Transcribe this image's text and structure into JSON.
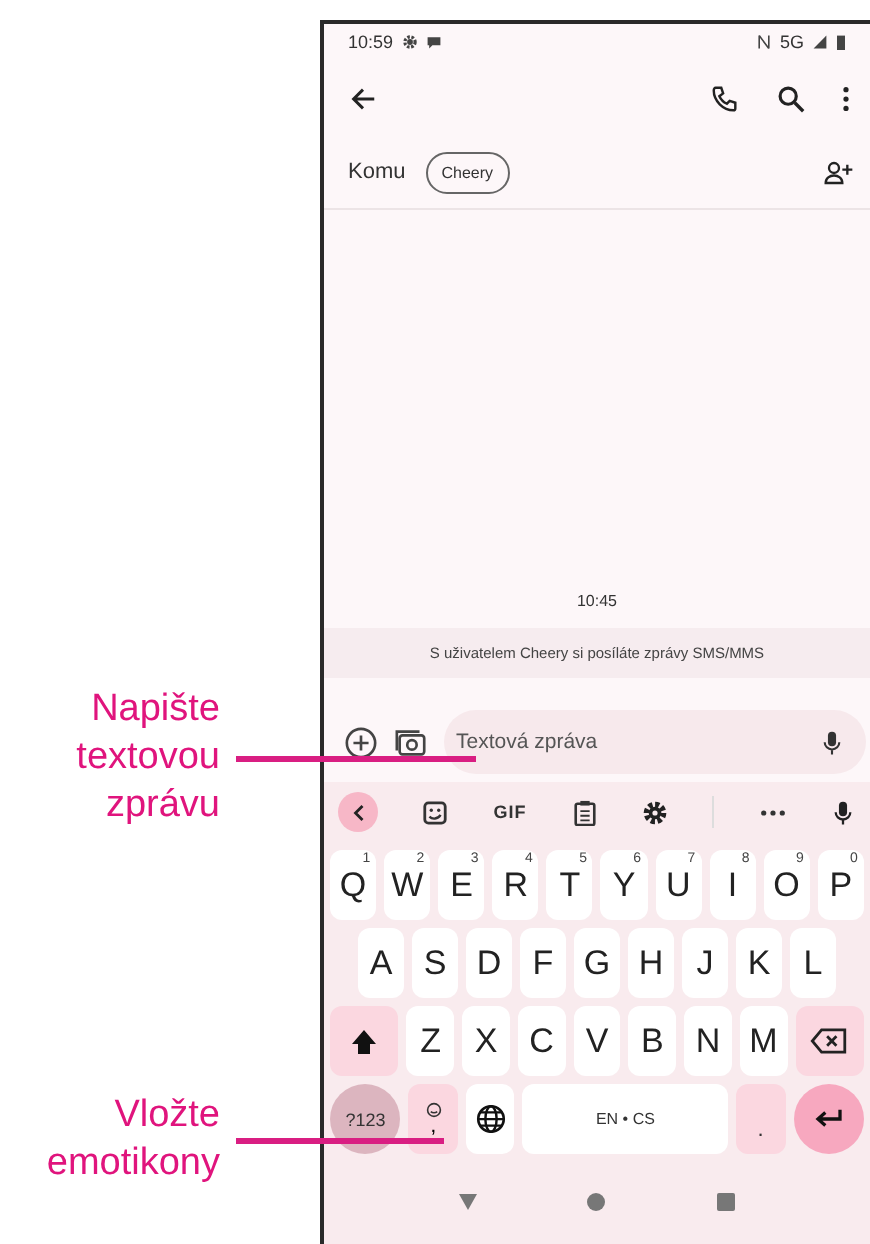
{
  "status_bar": {
    "time": "10:59",
    "network": "5G"
  },
  "recipients": {
    "label": "Komu",
    "chips": [
      "Cheery"
    ]
  },
  "conversation": {
    "timestamp": "10:45",
    "notice": "S uživatelem Cheery si posíláte zprávy SMS/MMS"
  },
  "compose": {
    "placeholder": "Textová zpráva"
  },
  "keyboard": {
    "toolbar_label": "GIF",
    "top_row": [
      {
        "kind": "letter",
        "label": "Q",
        "hint": "1"
      },
      {
        "kind": "letter",
        "label": "W",
        "hint": "2"
      },
      {
        "kind": "letter",
        "label": "E",
        "hint": "3"
      },
      {
        "kind": "letter",
        "label": "R",
        "hint": "4"
      },
      {
        "kind": "letter",
        "label": "T",
        "hint": "5"
      },
      {
        "kind": "letter",
        "label": "Y",
        "hint": "6"
      },
      {
        "kind": "letter",
        "label": "U",
        "hint": "7"
      },
      {
        "kind": "letter",
        "label": "I",
        "hint": "8"
      },
      {
        "kind": "letter",
        "label": "O",
        "hint": "9"
      },
      {
        "kind": "letter",
        "label": "P",
        "hint": "0"
      }
    ],
    "home_row": [
      {
        "kind": "letter",
        "label": "A"
      },
      {
        "kind": "letter",
        "label": "S"
      },
      {
        "kind": "letter",
        "label": "D"
      },
      {
        "kind": "letter",
        "label": "F"
      },
      {
        "kind": "letter",
        "label": "G"
      },
      {
        "kind": "letter",
        "label": "H"
      },
      {
        "kind": "letter",
        "label": "J"
      },
      {
        "kind": "letter",
        "label": "K"
      },
      {
        "kind": "letter",
        "label": "L"
      }
    ],
    "lower_row": [
      {
        "kind": "shift"
      },
      {
        "kind": "letter",
        "label": "Z"
      },
      {
        "kind": "letter",
        "label": "X"
      },
      {
        "kind": "letter",
        "label": "C"
      },
      {
        "kind": "letter",
        "label": "V"
      },
      {
        "kind": "letter",
        "label": "B"
      },
      {
        "kind": "letter",
        "label": "N"
      },
      {
        "kind": "letter",
        "label": "M"
      },
      {
        "kind": "backspace"
      }
    ],
    "function_row": [
      {
        "kind": "symbols",
        "label": "?123"
      },
      {
        "kind": "emoji",
        "label": ","
      },
      {
        "kind": "globe"
      },
      {
        "kind": "space",
        "label": "EN • CS"
      },
      {
        "kind": "period",
        "label": "."
      },
      {
        "kind": "enter"
      }
    ]
  },
  "callouts": [
    {
      "text": "Napište\ntextovou\nzprávu"
    },
    {
      "text": "Vložte\nemotikony"
    }
  ]
}
